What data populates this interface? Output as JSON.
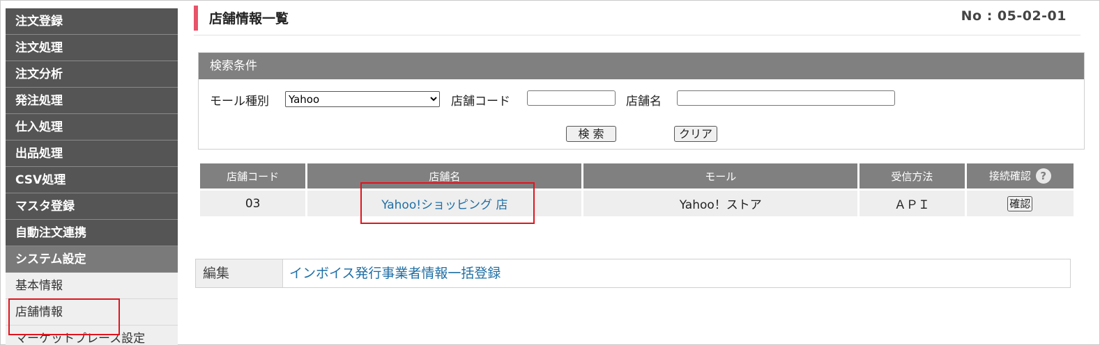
{
  "sidebar": {
    "items": [
      {
        "label": "注文登録"
      },
      {
        "label": "注文処理"
      },
      {
        "label": "注文分析"
      },
      {
        "label": "発注処理"
      },
      {
        "label": "仕入処理"
      },
      {
        "label": "出品処理"
      },
      {
        "label": "CSV処理"
      },
      {
        "label": "マスタ登録"
      },
      {
        "label": "自動注文連携"
      },
      {
        "label": "システム設定"
      }
    ],
    "sub_items": [
      {
        "label": "基本情報"
      },
      {
        "label": "店舗情報"
      },
      {
        "label": "マーケットプレース設定"
      }
    ]
  },
  "header": {
    "title": "店舗情報一覧",
    "page_no": "No : 05-02-01"
  },
  "search": {
    "heading": "検索条件",
    "mall_label": "モール種別",
    "mall_selected": "Yahoo",
    "code_label": "店舗コード",
    "code_value": "",
    "name_label": "店舗名",
    "name_value": "",
    "search_button": "検 索",
    "clear_button": "クリア"
  },
  "table": {
    "columns": [
      "店舗コード",
      "店舗名",
      "モール",
      "受信方法",
      "接続確認"
    ],
    "help_icon": "?",
    "rows": [
      {
        "code": "03",
        "name": "Yahoo!ショッピング 店",
        "mall": "Yahoo！ストア",
        "method": "ＡＰＩ",
        "confirm": "確認"
      }
    ]
  },
  "edit": {
    "label": "編集",
    "link": "インボイス発行事業者情報一括登録"
  },
  "colors": {
    "sidebar": "#555555",
    "accent": "#e8546a",
    "header_gray": "#808080",
    "link": "#1f6fa5",
    "highlight": "#e0141e"
  }
}
